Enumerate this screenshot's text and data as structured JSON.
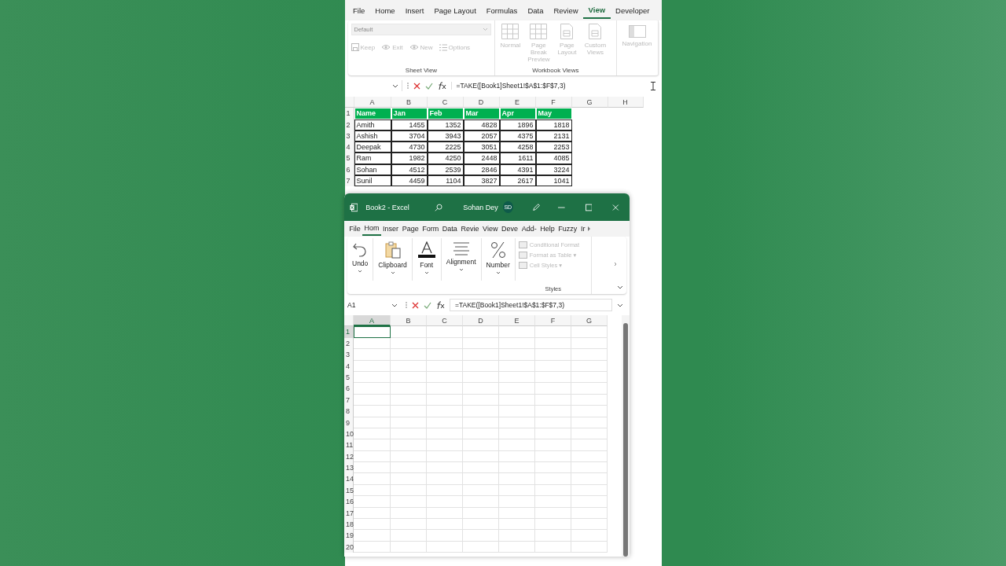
{
  "back_window": {
    "tabs": [
      {
        "label": "File",
        "selected": false
      },
      {
        "label": "Home",
        "selected": false
      },
      {
        "label": "Insert",
        "selected": false
      },
      {
        "label": "Page Layout",
        "selected": false
      },
      {
        "label": "Formulas",
        "selected": false
      },
      {
        "label": "Data",
        "selected": false
      },
      {
        "label": "Review",
        "selected": false
      },
      {
        "label": "View",
        "selected": true
      },
      {
        "label": "Developer",
        "selected": false
      }
    ],
    "sheet_view": {
      "dropdown": "Default",
      "buttons": [
        {
          "label": "Keep",
          "kind": "save",
          "disabled": true
        },
        {
          "label": "Exit",
          "kind": "eye",
          "disabled": true
        },
        {
          "label": "New",
          "kind": "eye",
          "disabled": true
        },
        {
          "label": "Options",
          "kind": "list",
          "disabled": true
        }
      ],
      "label": "Sheet View"
    },
    "workbook_views": {
      "buttons": [
        {
          "label": "Normal",
          "kind": "grid",
          "disabled": true
        },
        {
          "label": "Page Break Preview",
          "kind": "grid",
          "disabled": true
        },
        {
          "label": "Page Layout",
          "kind": "page",
          "disabled": true
        },
        {
          "label": "Custom Views",
          "kind": "page",
          "disabled": true
        }
      ],
      "label": "Workbook Views"
    },
    "navigation": {
      "label": "Navigation",
      "disabled": true
    },
    "formula": "=TAKE([Book1]Sheet1!$A$1:$F$7,3)",
    "columns": [
      "A",
      "B",
      "C",
      "D",
      "E",
      "F",
      "G",
      "H"
    ],
    "rows": [
      {
        "number": "1",
        "kind": "header",
        "cells": [
          "Name",
          "Jan",
          "Feb",
          "Mar",
          "Apr",
          "May"
        ]
      },
      {
        "number": "2",
        "kind": "data",
        "cells": [
          "Amith",
          "1455",
          "1352",
          "4828",
          "1896",
          "1818"
        ]
      },
      {
        "number": "3",
        "kind": "data",
        "cells": [
          "Ashish",
          "3704",
          "3943",
          "2057",
          "4375",
          "2131"
        ]
      },
      {
        "number": "4",
        "kind": "data",
        "cells": [
          "Deepak",
          "4730",
          "2225",
          "3051",
          "4258",
          "2253"
        ]
      },
      {
        "number": "5",
        "kind": "data",
        "cells": [
          "Ram",
          "1982",
          "4250",
          "2448",
          "1611",
          "4085"
        ]
      },
      {
        "number": "6",
        "kind": "data",
        "cells": [
          "Sohan",
          "4512",
          "2539",
          "2846",
          "4391",
          "3224"
        ]
      },
      {
        "number": "7",
        "kind": "data",
        "cells": [
          "Sunil",
          "4459",
          "1104",
          "3827",
          "2617",
          "1041"
        ]
      }
    ]
  },
  "front_window": {
    "title": "Book2  -  Excel",
    "user": "Sohan Dey",
    "initials": "SD",
    "tabs": [
      {
        "label": "File",
        "selected": false
      },
      {
        "label": "Hom",
        "selected": true
      },
      {
        "label": "Inser",
        "selected": false
      },
      {
        "label": "Page",
        "selected": false
      },
      {
        "label": "Form",
        "selected": false
      },
      {
        "label": "Data",
        "selected": false
      },
      {
        "label": "Revie",
        "selected": false
      },
      {
        "label": "View",
        "selected": false
      },
      {
        "label": "Deve",
        "selected": false
      },
      {
        "label": "Add-",
        "selected": false
      },
      {
        "label": "Help",
        "selected": false
      },
      {
        "label": "Fuzzy",
        "selected": false
      },
      {
        "label": "Ir",
        "selected": false
      }
    ],
    "groups": [
      {
        "label": "Undo",
        "kind": "undo"
      },
      {
        "label": "Clipboard",
        "kind": "clipboard"
      },
      {
        "label": "Font",
        "kind": "font"
      },
      {
        "label": "Alignment",
        "kind": "align"
      },
      {
        "label": "Number",
        "kind": "percent"
      }
    ],
    "styles": {
      "items": [
        {
          "label": "Conditional Format",
          "disabled": true
        },
        {
          "label": "Format as Table ▾",
          "disabled": true
        },
        {
          "label": "Cell Styles ▾",
          "disabled": true
        }
      ],
      "label": "Styles"
    },
    "name_box": "A1",
    "formula": "=TAKE([Book1]Sheet1!$A$1:$F$7,3)",
    "columns": [
      {
        "label": "A",
        "selected": true
      },
      {
        "label": "B",
        "selected": false
      },
      {
        "label": "C",
        "selected": false
      },
      {
        "label": "D",
        "selected": false
      },
      {
        "label": "E",
        "selected": false
      },
      {
        "label": "F",
        "selected": false
      },
      {
        "label": "G",
        "selected": false
      }
    ],
    "rows": [
      {
        "number": "1",
        "selected": true
      },
      {
        "number": "2",
        "selected": false
      },
      {
        "number": "3",
        "selected": false
      },
      {
        "number": "4",
        "selected": false
      },
      {
        "number": "5",
        "selected": false
      },
      {
        "number": "6",
        "selected": false
      },
      {
        "number": "7",
        "selected": false
      },
      {
        "number": "8",
        "selected": false
      },
      {
        "number": "9",
        "selected": false
      },
      {
        "number": "10",
        "selected": false
      },
      {
        "number": "11",
        "selected": false
      },
      {
        "number": "12",
        "selected": false
      },
      {
        "number": "13",
        "selected": false
      },
      {
        "number": "14",
        "selected": false
      },
      {
        "number": "15",
        "selected": false
      },
      {
        "number": "16",
        "selected": false
      },
      {
        "number": "17",
        "selected": false
      },
      {
        "number": "18",
        "selected": false
      },
      {
        "number": "19",
        "selected": false
      },
      {
        "number": "20",
        "selected": false
      }
    ]
  }
}
